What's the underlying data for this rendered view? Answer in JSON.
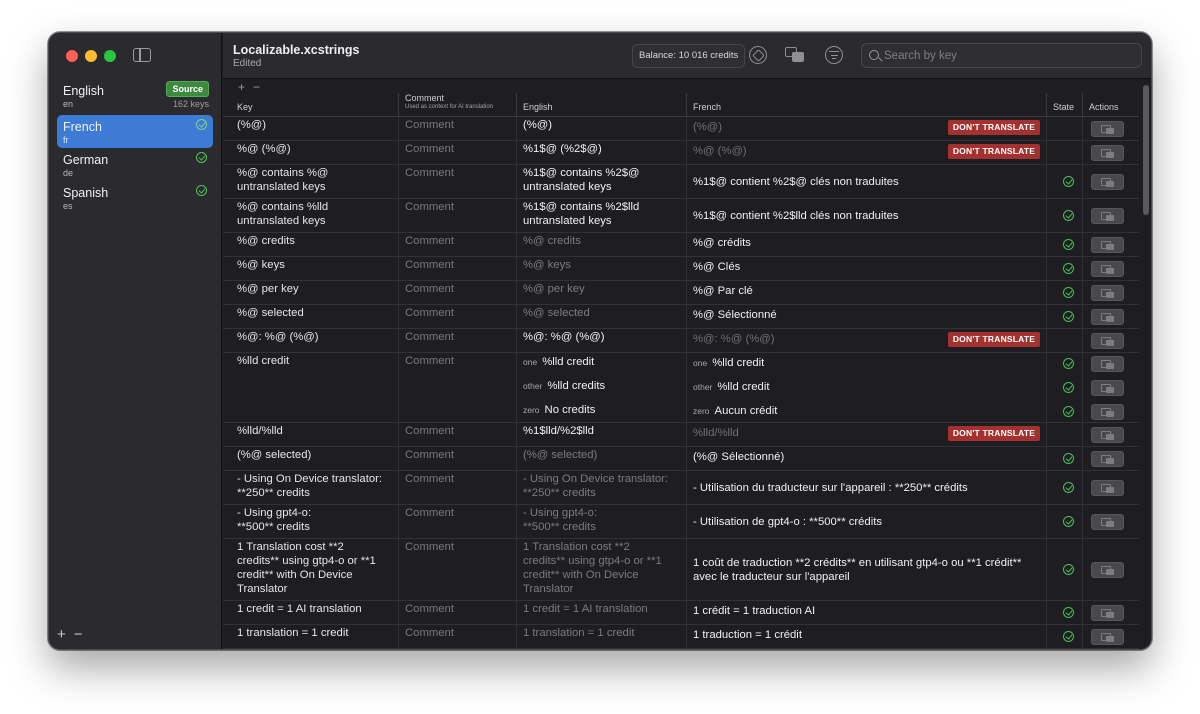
{
  "window": {
    "title": "Localizable.xcstrings",
    "subtitle": "Edited"
  },
  "sidebar": {
    "languages": [
      {
        "name": "English",
        "code": "en",
        "badge": "Source",
        "count": "162 keys",
        "selected": false
      },
      {
        "name": "French",
        "code": "fr",
        "selected": true,
        "status": "check-icon"
      },
      {
        "name": "German",
        "code": "de",
        "selected": false,
        "status": "check-icon"
      },
      {
        "name": "Spanish",
        "code": "es",
        "selected": false,
        "status": "check-icon"
      }
    ],
    "footer": {
      "add": "+",
      "remove": "−"
    }
  },
  "toolbar": {
    "balance": "Balance: 10 016 credits",
    "icons": [
      "openai-icon",
      "translate-icon",
      "filter-icon"
    ],
    "search_placeholder": "Search by key"
  },
  "table": {
    "add": "+",
    "remove": "−",
    "headers": {
      "key": "Key",
      "comment": "Comment",
      "comment_sub": "Used as context for AI translation",
      "english": "English",
      "french": "French",
      "state": "State",
      "actions": "Actions"
    },
    "comment_placeholder": "Comment",
    "dont_translate": "DON'T TRANSLATE",
    "rows": [
      {
        "key": "(%@)",
        "en": "(%@)",
        "en_style": "value",
        "fr": "(%@)",
        "fr_style": "ph",
        "state": "dnt"
      },
      {
        "key": "%@ (%@)",
        "en": "%1$@ (%2$@)",
        "en_style": "value",
        "fr": "%@ (%@)",
        "fr_style": "ph",
        "state": "dnt"
      },
      {
        "key": "%@ contains %@\nuntranslated keys",
        "en": "%1$@ contains %2$@\nuntranslated keys",
        "en_style": "value",
        "fr": "%1$@ contient %2$@ clés non traduites",
        "fr_style": "value",
        "state": "ok"
      },
      {
        "key": "%@ contains %lld\nuntranslated keys",
        "en": "%1$@ contains %2$lld\nuntranslated keys",
        "en_style": "value",
        "fr": "%1$@ contient %2$lld clés non traduites",
        "fr_style": "value",
        "state": "ok"
      },
      {
        "key": "%@ credits",
        "en": "%@ credits",
        "en_style": "ph",
        "fr": "%@ crédits",
        "fr_style": "value",
        "state": "ok"
      },
      {
        "key": "%@ keys",
        "en": "%@ keys",
        "en_style": "ph",
        "fr": "%@ Clés",
        "fr_style": "value",
        "state": "ok"
      },
      {
        "key": "%@ per key",
        "en": "%@ per key",
        "en_style": "ph",
        "fr": "%@ Par clé",
        "fr_style": "value",
        "state": "ok"
      },
      {
        "key": "%@ selected",
        "en": "%@ selected",
        "en_style": "ph",
        "fr": "%@ Sélectionné",
        "fr_style": "value",
        "state": "ok"
      },
      {
        "key": "%@: %@ (%@)",
        "en": "%@: %@ (%@)",
        "en_style": "value",
        "fr": "%@: %@ (%@)",
        "fr_style": "ph",
        "state": "dnt"
      },
      {
        "key": "%lld credit",
        "plural": [
          {
            "form": "one",
            "en": "%lld credit",
            "fr": "%lld credit"
          },
          {
            "form": "other",
            "en": "%lld credits",
            "fr": "%lld credit"
          },
          {
            "form": "zero",
            "en": "No credits",
            "fr": "Aucun crédit"
          }
        ],
        "state": "ok"
      },
      {
        "key": "%lld/%lld",
        "en": "%1$lld/%2$lld",
        "en_style": "value",
        "fr": "%lld/%lld",
        "fr_style": "ph",
        "state": "dnt"
      },
      {
        "key": "(%@ selected)",
        "en": "(%@ selected)",
        "en_style": "ph",
        "fr": "(%@ Sélectionné)",
        "fr_style": "value",
        "state": "ok"
      },
      {
        "key": "- Using On Device translator:\n**250** credits",
        "en": "- Using On Device translator:\n**250** credits",
        "en_style": "ph",
        "fr": "- Utilisation du traducteur sur l'appareil : **250** crédits",
        "fr_style": "value",
        "state": "ok"
      },
      {
        "key": "- Using gpt4-o:\n**500** credits",
        "en": "- Using gpt4-o:\n**500** credits",
        "en_style": "ph",
        "fr": "- Utilisation de gpt4-o : **500** crédits",
        "fr_style": "value",
        "state": "ok"
      },
      {
        "key": "1 Translation cost **2\ncredits** using gtp4-o or **1\ncredit** with On Device\nTranslator",
        "en": "1 Translation cost **2\ncredits** using gtp4-o or **1\ncredit** with On Device\nTranslator",
        "en_style": "ph",
        "fr": "1 coût de traduction **2 crédits** en utilisant gtp4-o ou **1 crédit**\navec le traducteur sur l'appareil",
        "fr_style": "value",
        "state": "ok"
      },
      {
        "key": "1 credit = 1 AI translation",
        "en": "1 credit = 1 AI translation",
        "en_style": "ph",
        "fr": "1 crédit = 1 traduction AI",
        "fr_style": "value",
        "state": "ok"
      },
      {
        "key": "1 translation = 1 credit",
        "en": "1 translation = 1 credit",
        "en_style": "ph",
        "fr": "1 traduction = 1 crédit",
        "fr_style": "value",
        "state": "ok"
      }
    ]
  },
  "colors": {
    "accent": "#3d7bd5",
    "source_badge": "#3b8a3e",
    "dont_translate": "#a33130",
    "check": "#49c057"
  }
}
